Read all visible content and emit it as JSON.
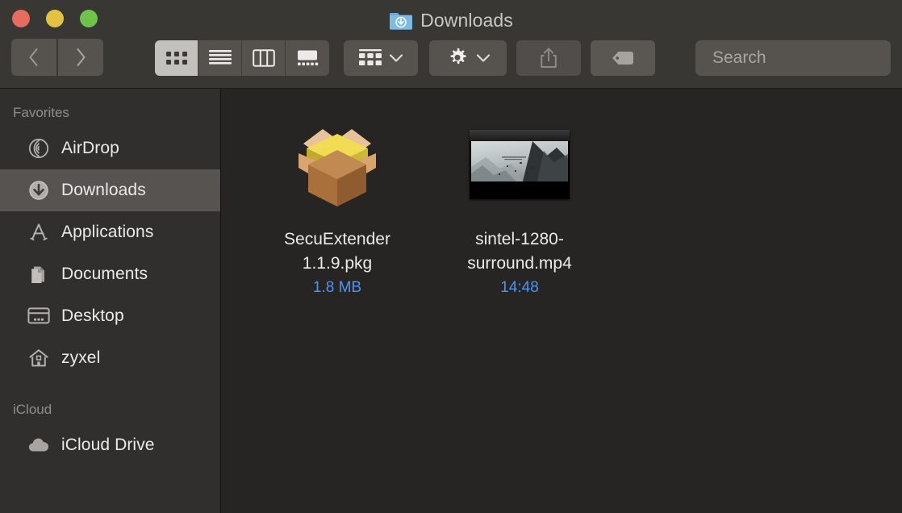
{
  "window": {
    "title": "Downloads",
    "title_icon": "downloads-folder-icon",
    "traffic_lights": [
      {
        "name": "close",
        "color": "#e86b60"
      },
      {
        "name": "minimize",
        "color": "#e3c142"
      },
      {
        "name": "maximize",
        "color": "#6fc24a"
      }
    ]
  },
  "toolbar": {
    "back_icon": "chevron-left-icon",
    "forward_icon": "chevron-right-icon",
    "view_modes": [
      {
        "name": "icon-view",
        "icon": "grid-icon",
        "selected": true
      },
      {
        "name": "list-view",
        "icon": "list-lines-icon",
        "selected": false
      },
      {
        "name": "column-view",
        "icon": "columns-icon",
        "selected": false
      },
      {
        "name": "gallery-view",
        "icon": "gallery-icon",
        "selected": false
      }
    ],
    "arrange_icon": "group-grid-icon",
    "arrange_chevron": "chevron-down-icon",
    "action_icon": "gear-icon",
    "action_chevron": "chevron-down-icon",
    "share_icon": "share-icon",
    "tags_icon": "tag-icon"
  },
  "search": {
    "icon": "search-icon",
    "placeholder": "Search",
    "value": ""
  },
  "sidebar": {
    "sections": [
      {
        "label": "Favorites",
        "items": [
          {
            "label": "AirDrop",
            "icon": "airdrop-icon",
            "selected": false
          },
          {
            "label": "Downloads",
            "icon": "download-arrow-icon",
            "selected": true
          },
          {
            "label": "Applications",
            "icon": "applications-icon",
            "selected": false
          },
          {
            "label": "Documents",
            "icon": "documents-icon",
            "selected": false
          },
          {
            "label": "Desktop",
            "icon": "desktop-icon",
            "selected": false
          },
          {
            "label": "zyxel",
            "icon": "home-icon",
            "selected": false
          }
        ]
      },
      {
        "label": "iCloud",
        "items": [
          {
            "label": "iCloud Drive",
            "icon": "cloud-icon",
            "selected": false
          }
        ]
      }
    ]
  },
  "content": {
    "files": [
      {
        "name": "SecuExtender 1.1.9.pkg",
        "meta": "1.8 MB",
        "icon": "package-box-icon",
        "selected": false
      },
      {
        "name": "sintel-1280-surround.mp4",
        "meta": "14:48",
        "icon": "video-thumbnail",
        "selected": false
      }
    ]
  },
  "colors": {
    "toolbar_bg": "#393734",
    "sidebar_bg": "#302f2e",
    "content_bg": "#262524",
    "selection_bg": "#565350",
    "meta_blue": "#4a94f7",
    "text_primary": "#eceae8",
    "text_secondary": "#918e8a"
  }
}
